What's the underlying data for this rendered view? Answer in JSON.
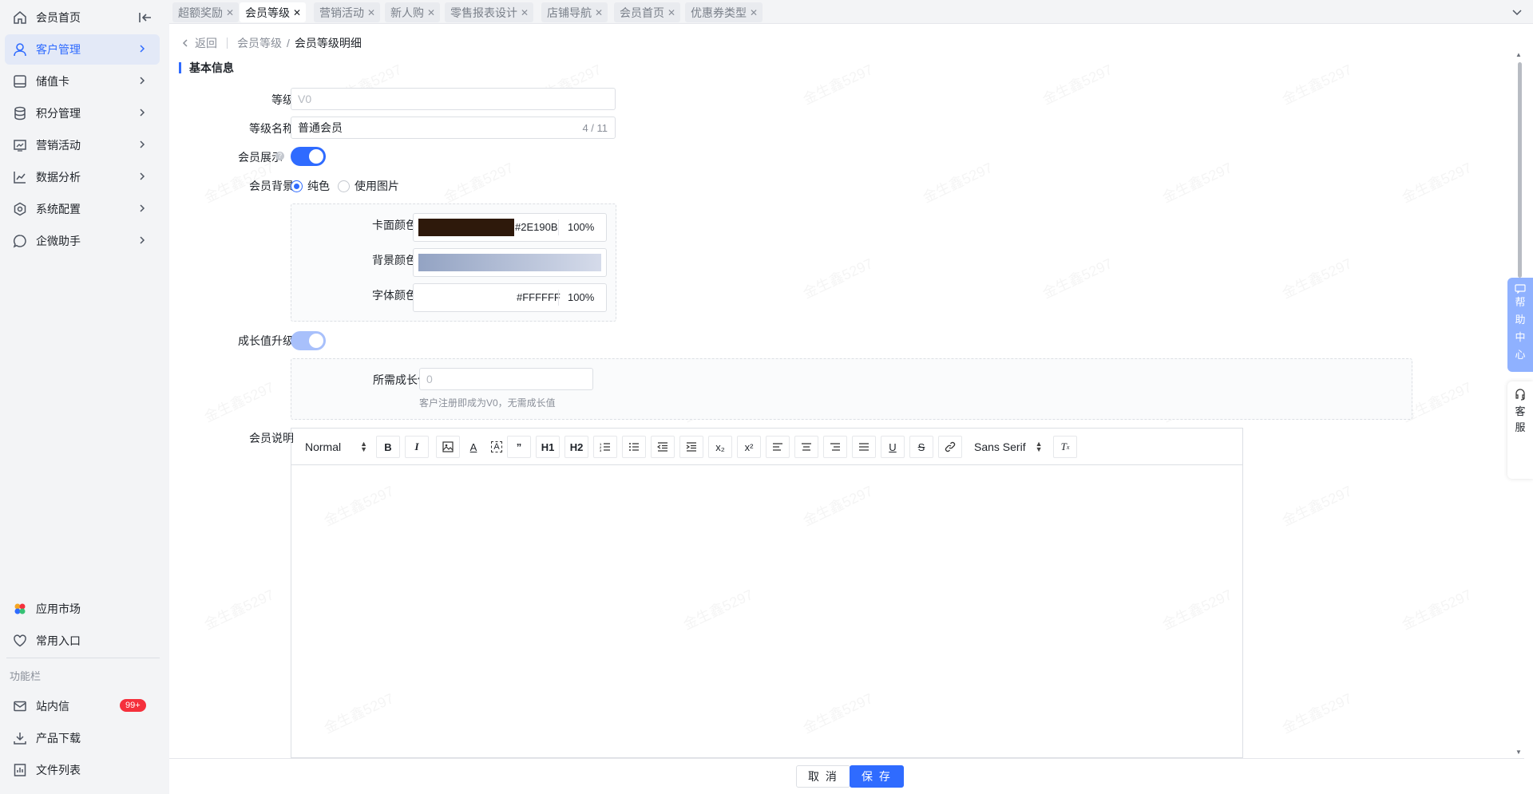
{
  "sidebar": {
    "items": [
      {
        "label": "会员首页",
        "icon": "home-icon"
      },
      {
        "label": "客户管理",
        "icon": "user-icon"
      },
      {
        "label": "储值卡",
        "icon": "card-icon"
      },
      {
        "label": "积分管理",
        "icon": "database-icon"
      },
      {
        "label": "营销活动",
        "icon": "chart-board-icon"
      },
      {
        "label": "数据分析",
        "icon": "line-chart-icon"
      },
      {
        "label": "系统配置",
        "icon": "settings-icon"
      },
      {
        "label": "企微助手",
        "icon": "chat-icon"
      }
    ],
    "bottom": {
      "app_market": "应用市场",
      "favorites": "常用入口",
      "section_label": "功能栏",
      "messages": "站内信",
      "messages_badge": "99+",
      "download": "产品下载",
      "files": "文件列表"
    }
  },
  "tabs": [
    "超额奖励",
    "会员等级",
    "营销活动",
    "新人购",
    "零售报表设计",
    "店铺导航",
    "会员首页",
    "优惠券类型"
  ],
  "active_tab": 1,
  "breadcrumb": {
    "back": "返回",
    "parent": "会员等级",
    "separator": "/",
    "current": "会员等级明细"
  },
  "section_title": "基本信息",
  "form": {
    "level_label": "等级",
    "level_placeholder": "V0",
    "name_label": "等级名称",
    "name_value": "普通会员",
    "name_counter": "4 / 11",
    "display_label": "会员展示",
    "display_enabled": true,
    "bg_label": "会员背景",
    "bg_option_solid": "纯色",
    "bg_option_image": "使用图片",
    "card_color_label": "卡面颜色",
    "card_color_hex": "#2E190B",
    "card_color_opacity": "100%",
    "bg_color_label": "背景颜色",
    "font_color_label": "字体颜色",
    "font_color_hex": "#FFFFFF",
    "font_color_opacity": "100%",
    "growth_label": "成长值升级",
    "growth_enabled": true,
    "required_growth_label": "所需成长值",
    "required_growth_placeholder": "0",
    "required_growth_hint": "客户注册即成为V0，无需成长值",
    "desc_label": "会员说明"
  },
  "editor": {
    "header_select": "Normal",
    "font_select": "Sans Serif",
    "tools": [
      "bold-icon",
      "italic-icon",
      "image-icon",
      "font-color-icon",
      "background-color-icon",
      "blockquote-icon",
      "h1-icon",
      "h2-icon",
      "ordered-list-icon",
      "bullet-list-icon",
      "outdent-icon",
      "indent-icon",
      "subscript-icon",
      "superscript-icon",
      "align-left-icon",
      "align-center-icon",
      "align-right-icon",
      "align-justify-icon",
      "underline-icon",
      "strikethrough-icon",
      "link-icon",
      "clear-format-icon"
    ],
    "h1": "H1",
    "h2": "H2",
    "sub": "x₂",
    "sup": "x²"
  },
  "footer": {
    "cancel": "取 消",
    "save": "保 存"
  },
  "floats": {
    "help": [
      "帮",
      "助",
      "中",
      "心"
    ],
    "service": [
      "客",
      "服"
    ]
  },
  "watermark": "金生鑫5297",
  "colors": {
    "primary": "#2F6BFF",
    "card_swatch": "#2E190B",
    "sidebar_bg": "#F3F4F6",
    "badge": "#F5303C"
  }
}
